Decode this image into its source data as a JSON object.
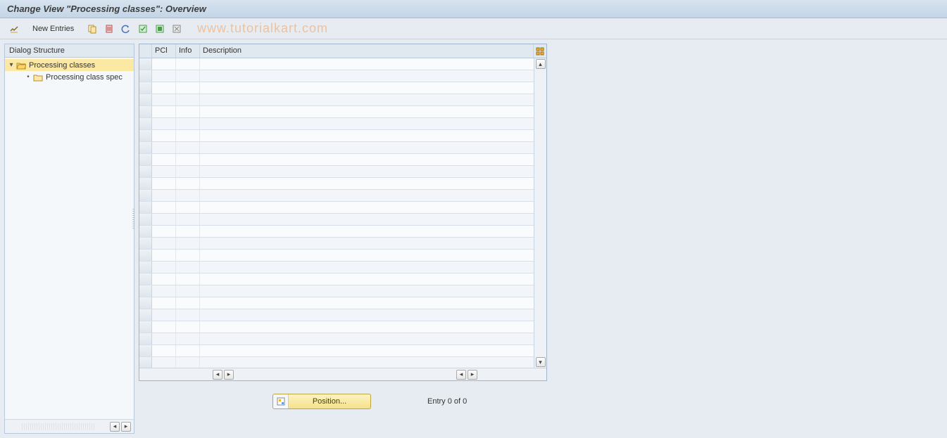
{
  "header": {
    "title": "Change View \"Processing classes\": Overview"
  },
  "toolbar": {
    "new_entries_label": "New Entries",
    "watermark": "www.tutorialkart.com"
  },
  "sidebar": {
    "title": "Dialog Structure",
    "items": [
      {
        "label": "Processing classes",
        "selected": true,
        "open": true
      },
      {
        "label": "Processing class spec",
        "selected": false,
        "open": false
      }
    ]
  },
  "grid": {
    "columns": {
      "pcl": "PCl",
      "info": "Info",
      "description": "Description"
    },
    "row_count": 26
  },
  "footer": {
    "position_label": "Position...",
    "entry_text": "Entry 0 of 0"
  }
}
